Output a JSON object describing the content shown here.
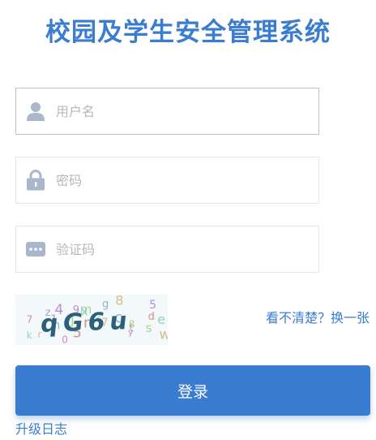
{
  "page": {
    "title": "校园及学生安全管理系统"
  },
  "form": {
    "username": {
      "placeholder": "用户名",
      "value": "",
      "icon": "user-icon"
    },
    "password": {
      "placeholder": "密码",
      "value": "",
      "icon": "lock-icon"
    },
    "captcha": {
      "placeholder": "验证码",
      "value": "",
      "icon": "keyboard-icon"
    },
    "captcha_image": {
      "text": "qG6u",
      "noise": [
        "7",
        "h",
        "m",
        "8",
        "5",
        "k",
        "0",
        "n",
        "c",
        "s",
        "r",
        "9",
        "2",
        "t",
        "d",
        "z",
        "j",
        "7",
        "y",
        "e",
        "1",
        "5",
        "g",
        "8",
        "w",
        "4",
        "x"
      ]
    },
    "refresh_link": "看不清楚？换一张",
    "submit_label": "登录"
  },
  "footer": {
    "changelog_link": "升级日志"
  },
  "colors": {
    "accent": "#3a7ccf",
    "icon": "#a9b6cb"
  }
}
